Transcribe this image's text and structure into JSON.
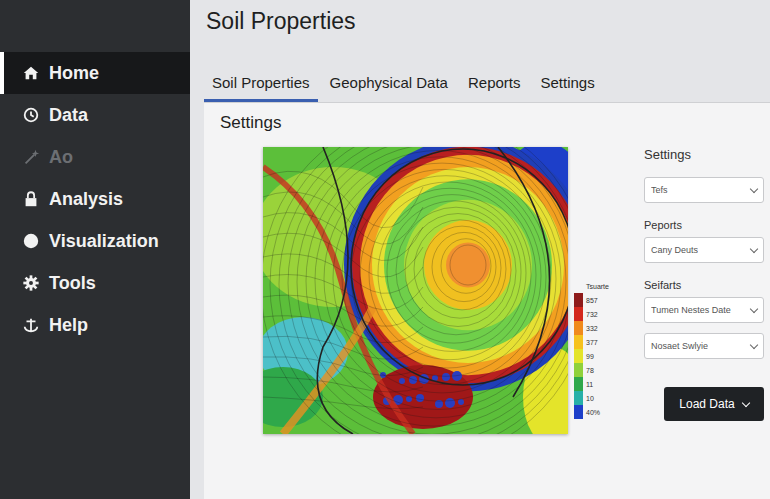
{
  "page": {
    "title": "Soil Properties"
  },
  "sidebar": {
    "items": [
      {
        "label": "Home",
        "icon": "home",
        "selected": true,
        "disabled": false
      },
      {
        "label": "Data",
        "icon": "clock",
        "selected": false,
        "disabled": false
      },
      {
        "label": "Ao",
        "icon": "wand",
        "selected": false,
        "disabled": true
      },
      {
        "label": "Analysis",
        "icon": "lock",
        "selected": false,
        "disabled": false
      },
      {
        "label": "Visualization",
        "icon": "circle",
        "selected": false,
        "disabled": false
      },
      {
        "label": "Tools",
        "icon": "gear",
        "selected": false,
        "disabled": false
      },
      {
        "label": "Help",
        "icon": "anchor",
        "selected": false,
        "disabled": false
      }
    ]
  },
  "tabs": [
    {
      "label": "Soil Properties",
      "selected": true
    },
    {
      "label": "Geophysical Data",
      "selected": false
    },
    {
      "label": "Reports",
      "selected": false
    },
    {
      "label": "Settings",
      "selected": false
    }
  ],
  "panel": {
    "title": "Settings"
  },
  "legend": {
    "title": "Tsuarte",
    "entries": [
      {
        "label": "857",
        "color": "#8e1b1b"
      },
      {
        "label": "732",
        "color": "#d3281e"
      },
      {
        "label": "332",
        "color": "#f08a1c"
      },
      {
        "label": "377",
        "color": "#f6c21e"
      },
      {
        "label": "99",
        "color": "#e4e42a"
      },
      {
        "label": "78",
        "color": "#8fd13a"
      },
      {
        "label": "11",
        "color": "#2fa84a"
      },
      {
        "label": "10",
        "color": "#27b0a8"
      },
      {
        "label": "40%",
        "color": "#1d3fc9"
      }
    ]
  },
  "settings": {
    "title": "Settings",
    "groups": [
      {
        "label": null,
        "dropdowns": [
          "Tefs"
        ]
      },
      {
        "label": "Peports",
        "dropdowns": [
          "Cany Deuts"
        ]
      },
      {
        "label": "Seifarts",
        "dropdowns": [
          "Tumen Nestes Date",
          "Nosaet Swlyie"
        ]
      }
    ]
  },
  "button": {
    "label": "Load Data"
  }
}
